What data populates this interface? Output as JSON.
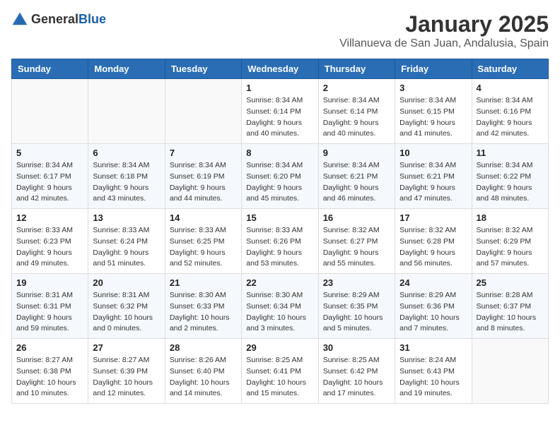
{
  "logo": {
    "general": "General",
    "blue": "Blue"
  },
  "header": {
    "month": "January 2025",
    "location": "Villanueva de San Juan, Andalusia, Spain"
  },
  "weekdays": [
    "Sunday",
    "Monday",
    "Tuesday",
    "Wednesday",
    "Thursday",
    "Friday",
    "Saturday"
  ],
  "weeks": [
    [
      {
        "day": "",
        "info": ""
      },
      {
        "day": "",
        "info": ""
      },
      {
        "day": "",
        "info": ""
      },
      {
        "day": "1",
        "info": "Sunrise: 8:34 AM\nSunset: 6:14 PM\nDaylight: 9 hours\nand 40 minutes."
      },
      {
        "day": "2",
        "info": "Sunrise: 8:34 AM\nSunset: 6:14 PM\nDaylight: 9 hours\nand 40 minutes."
      },
      {
        "day": "3",
        "info": "Sunrise: 8:34 AM\nSunset: 6:15 PM\nDaylight: 9 hours\nand 41 minutes."
      },
      {
        "day": "4",
        "info": "Sunrise: 8:34 AM\nSunset: 6:16 PM\nDaylight: 9 hours\nand 42 minutes."
      }
    ],
    [
      {
        "day": "5",
        "info": "Sunrise: 8:34 AM\nSunset: 6:17 PM\nDaylight: 9 hours\nand 42 minutes."
      },
      {
        "day": "6",
        "info": "Sunrise: 8:34 AM\nSunset: 6:18 PM\nDaylight: 9 hours\nand 43 minutes."
      },
      {
        "day": "7",
        "info": "Sunrise: 8:34 AM\nSunset: 6:19 PM\nDaylight: 9 hours\nand 44 minutes."
      },
      {
        "day": "8",
        "info": "Sunrise: 8:34 AM\nSunset: 6:20 PM\nDaylight: 9 hours\nand 45 minutes."
      },
      {
        "day": "9",
        "info": "Sunrise: 8:34 AM\nSunset: 6:21 PM\nDaylight: 9 hours\nand 46 minutes."
      },
      {
        "day": "10",
        "info": "Sunrise: 8:34 AM\nSunset: 6:21 PM\nDaylight: 9 hours\nand 47 minutes."
      },
      {
        "day": "11",
        "info": "Sunrise: 8:34 AM\nSunset: 6:22 PM\nDaylight: 9 hours\nand 48 minutes."
      }
    ],
    [
      {
        "day": "12",
        "info": "Sunrise: 8:33 AM\nSunset: 6:23 PM\nDaylight: 9 hours\nand 49 minutes."
      },
      {
        "day": "13",
        "info": "Sunrise: 8:33 AM\nSunset: 6:24 PM\nDaylight: 9 hours\nand 51 minutes."
      },
      {
        "day": "14",
        "info": "Sunrise: 8:33 AM\nSunset: 6:25 PM\nDaylight: 9 hours\nand 52 minutes."
      },
      {
        "day": "15",
        "info": "Sunrise: 8:33 AM\nSunset: 6:26 PM\nDaylight: 9 hours\nand 53 minutes."
      },
      {
        "day": "16",
        "info": "Sunrise: 8:32 AM\nSunset: 6:27 PM\nDaylight: 9 hours\nand 55 minutes."
      },
      {
        "day": "17",
        "info": "Sunrise: 8:32 AM\nSunset: 6:28 PM\nDaylight: 9 hours\nand 56 minutes."
      },
      {
        "day": "18",
        "info": "Sunrise: 8:32 AM\nSunset: 6:29 PM\nDaylight: 9 hours\nand 57 minutes."
      }
    ],
    [
      {
        "day": "19",
        "info": "Sunrise: 8:31 AM\nSunset: 6:31 PM\nDaylight: 9 hours\nand 59 minutes."
      },
      {
        "day": "20",
        "info": "Sunrise: 8:31 AM\nSunset: 6:32 PM\nDaylight: 10 hours\nand 0 minutes."
      },
      {
        "day": "21",
        "info": "Sunrise: 8:30 AM\nSunset: 6:33 PM\nDaylight: 10 hours\nand 2 minutes."
      },
      {
        "day": "22",
        "info": "Sunrise: 8:30 AM\nSunset: 6:34 PM\nDaylight: 10 hours\nand 3 minutes."
      },
      {
        "day": "23",
        "info": "Sunrise: 8:29 AM\nSunset: 6:35 PM\nDaylight: 10 hours\nand 5 minutes."
      },
      {
        "day": "24",
        "info": "Sunrise: 8:29 AM\nSunset: 6:36 PM\nDaylight: 10 hours\nand 7 minutes."
      },
      {
        "day": "25",
        "info": "Sunrise: 8:28 AM\nSunset: 6:37 PM\nDaylight: 10 hours\nand 8 minutes."
      }
    ],
    [
      {
        "day": "26",
        "info": "Sunrise: 8:27 AM\nSunset: 6:38 PM\nDaylight: 10 hours\nand 10 minutes."
      },
      {
        "day": "27",
        "info": "Sunrise: 8:27 AM\nSunset: 6:39 PM\nDaylight: 10 hours\nand 12 minutes."
      },
      {
        "day": "28",
        "info": "Sunrise: 8:26 AM\nSunset: 6:40 PM\nDaylight: 10 hours\nand 14 minutes."
      },
      {
        "day": "29",
        "info": "Sunrise: 8:25 AM\nSunset: 6:41 PM\nDaylight: 10 hours\nand 15 minutes."
      },
      {
        "day": "30",
        "info": "Sunrise: 8:25 AM\nSunset: 6:42 PM\nDaylight: 10 hours\nand 17 minutes."
      },
      {
        "day": "31",
        "info": "Sunrise: 8:24 AM\nSunset: 6:43 PM\nDaylight: 10 hours\nand 19 minutes."
      },
      {
        "day": "",
        "info": ""
      }
    ]
  ]
}
